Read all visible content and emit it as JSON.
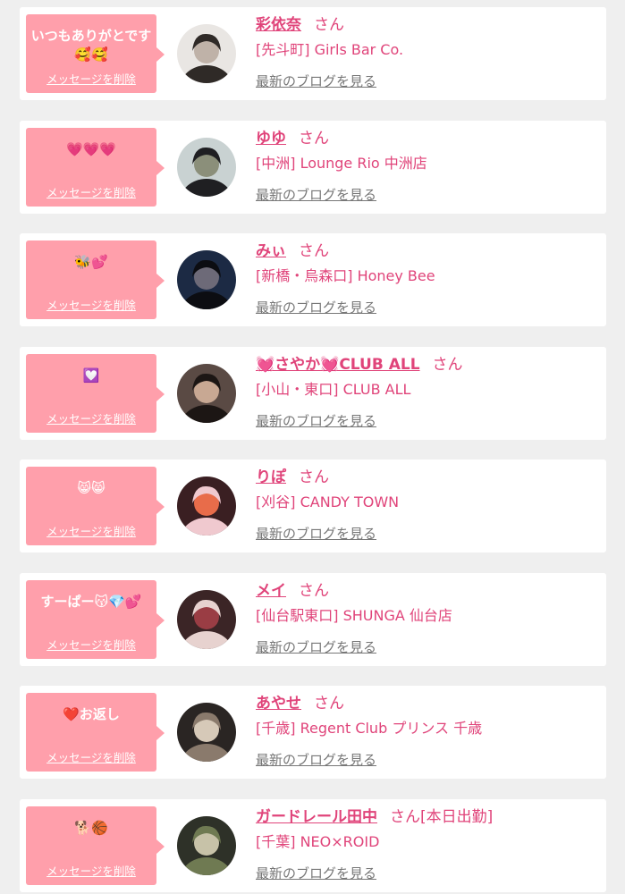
{
  "cards": [
    {
      "message": "いつもありがとです🥰🥰",
      "delete_label": "メッセージを削除",
      "name": "彩依奈",
      "honorific": "さん",
      "shop": "[先斗町] Girls Bar Co.",
      "blog_label": "最新のブログを見る",
      "avatar_colors": [
        "#e9e6e3",
        "#2f2a27",
        "#bfb2a8"
      ]
    },
    {
      "message": "💗💗💗",
      "delete_label": "メッセージを削除",
      "name": "ゆゆ",
      "honorific": "さん",
      "shop": "[中洲] Lounge Rio 中洲店",
      "blog_label": "最新のブログを見る",
      "avatar_colors": [
        "#c9d2d2",
        "#1f1f22",
        "#8b8f7a"
      ]
    },
    {
      "message": "🐝💕",
      "delete_label": "メッセージを削除",
      "name": "みぃ",
      "honorific": "さん",
      "shop": "[新橋・烏森口] Honey Bee",
      "blog_label": "最新のブログを見る",
      "avatar_colors": [
        "#1c2a44",
        "#0c0d12",
        "#6d6a78"
      ]
    },
    {
      "message": "💟",
      "delete_label": "メッセージを削除",
      "name": "💓さやか💓CLUB ALL",
      "honorific": "さん",
      "shop": "[小山・東口] CLUB ALL",
      "blog_label": "最新のブログを見る",
      "avatar_colors": [
        "#5a4a44",
        "#1c1614",
        "#c8a893"
      ]
    },
    {
      "message": "😸😸",
      "delete_label": "メッセージを削除",
      "name": "りぽ",
      "honorific": "さん",
      "shop": "[刈谷] CANDY TOWN",
      "blog_label": "最新のブログを見る",
      "avatar_colors": [
        "#3a1f22",
        "#f0c9cf",
        "#e86c4a"
      ]
    },
    {
      "message": "すーぱー😽💎💕",
      "delete_label": "メッセージを削除",
      "name": "メイ",
      "honorific": "さん",
      "shop": "[仙台駅東口] SHUNGA 仙台店",
      "blog_label": "最新のブログを見る",
      "avatar_colors": [
        "#3b2526",
        "#e7d2cf",
        "#9a3d44"
      ]
    },
    {
      "message": "❤️お返し",
      "delete_label": "メッセージを削除",
      "name": "あやせ",
      "honorific": "さん",
      "shop": "[千歳] Regent Club プリンス 千歳",
      "blog_label": "最新のブログを見る",
      "avatar_colors": [
        "#2a2523",
        "#8a7a6c",
        "#d6c9b8"
      ]
    },
    {
      "message": "🐕🏀",
      "delete_label": "メッセージを削除",
      "name": "ガードレール田中",
      "honorific": "さん[本日出勤]",
      "shop": "[千葉] NEO×ROID",
      "blog_label": "最新のブログを見る",
      "avatar_colors": [
        "#2e3128",
        "#6f7a52",
        "#c7c2a8"
      ]
    }
  ]
}
